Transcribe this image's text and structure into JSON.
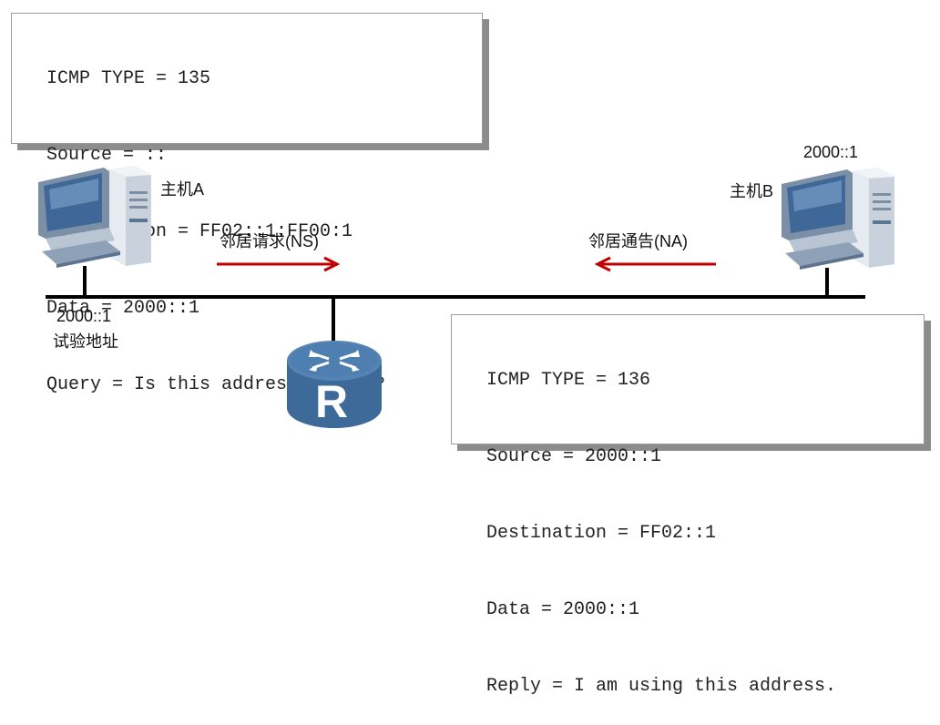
{
  "ns_packet": {
    "lines": [
      "ICMP TYPE = 135",
      "Source = ::",
      "Destination = FF02::1:FF00:1",
      "Data = 2000::1",
      "Query = Is this address in use?"
    ]
  },
  "na_packet": {
    "lines": [
      "ICMP TYPE = 136",
      "Source = 2000::1",
      "Destination = FF02::1",
      "Data = 2000::1",
      "Reply = I am using this address."
    ]
  },
  "host_a": {
    "name": "主机A",
    "address": "2000::1",
    "note": "试验地址",
    "icon": "computer-icon"
  },
  "host_b": {
    "name": "主机B",
    "address": "2000::1",
    "icon": "computer-icon"
  },
  "messages": {
    "ns": {
      "label": "邻居请求(NS)",
      "direction": "right"
    },
    "na": {
      "label": "邻居通告(NA)",
      "direction": "left"
    }
  },
  "router": {
    "letter": "R",
    "icon": "router-icon"
  },
  "colors": {
    "arrow": "#c00000",
    "router_body": "#3d6a98",
    "router_top": "#4f7fb0",
    "computer_screen": "#3f6898",
    "computer_case": "#dfe5ec",
    "box_shadow": "#8c8c8c"
  }
}
